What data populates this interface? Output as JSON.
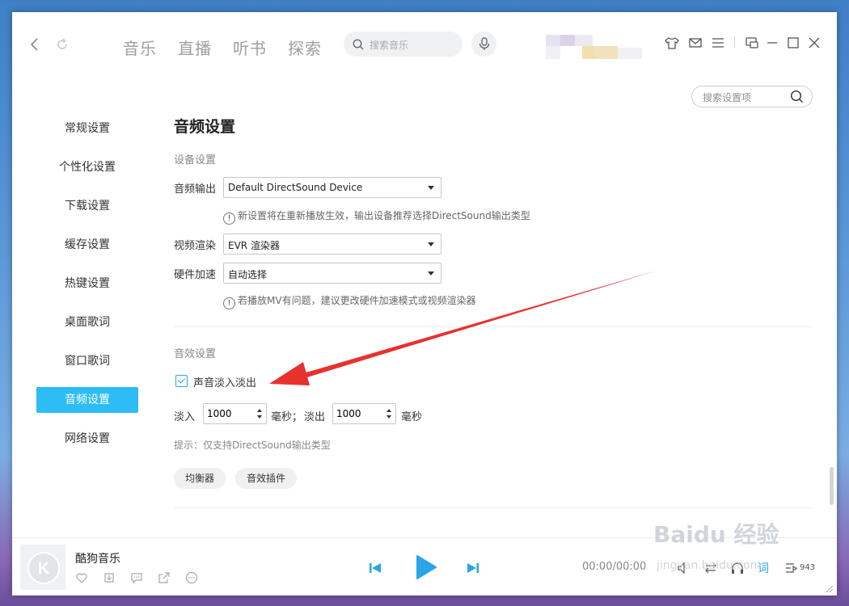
{
  "nav": {
    "tabs": [
      "音乐",
      "直播",
      "听书",
      "探索"
    ],
    "search_placeholder": "搜索音乐"
  },
  "settings_search": {
    "placeholder": "搜索设置项"
  },
  "sidebar": {
    "items": [
      "常规设置",
      "个性化设置",
      "下载设置",
      "缓存设置",
      "热键设置",
      "桌面歌词",
      "窗口歌词",
      "音频设置",
      "网络设置"
    ],
    "active_index": 7
  },
  "audio": {
    "title": "音频设置",
    "device_section": "设备设置",
    "output_label": "音频输出",
    "output_value": "Default DirectSound Device",
    "output_hint": "新设置将在重新播放生效，输出设备推荐选择DirectSound输出类型",
    "video_render_label": "视频渲染",
    "video_render_value": "EVR 渲染器",
    "hw_accel_label": "硬件加速",
    "hw_accel_value": "自动选择",
    "mv_hint": "若播放MV有问题，建议更改硬件加速模式或视频渲染器",
    "effect_section": "音效设置",
    "fade_checkbox_label": "声音淡入淡出",
    "fade_checked": true,
    "fade_in_label": "淡入",
    "fade_in_value": "1000",
    "fade_in_unit": "毫秒；",
    "fade_out_label": "淡出",
    "fade_out_value": "1000",
    "fade_out_unit": "毫秒",
    "tip": "提示：仅支持DirectSound输出类型",
    "equalizer_button": "均衡器",
    "plugin_button": "音效插件"
  },
  "player": {
    "song_title": "酷狗音乐",
    "time": "00:00/00:00",
    "lyric_label": "词",
    "playlist_count": "943"
  },
  "colors": {
    "accent": "#2dbcf5",
    "arrow": "#e8312f"
  },
  "watermark": {
    "brand": "Baidu 经验",
    "url": "jingyan.baidu.com"
  }
}
